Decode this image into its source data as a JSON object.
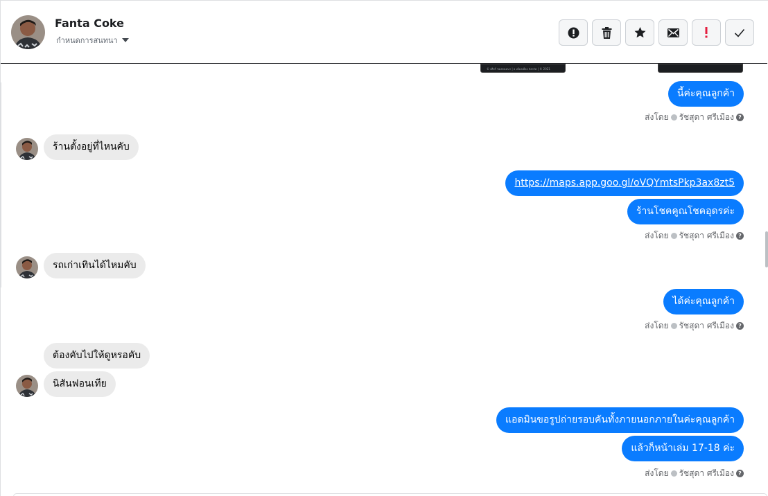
{
  "header": {
    "contact_name": "Fanta Coke",
    "conversation_settings": "กำหนดการสนทนา",
    "actions": [
      {
        "name": "report-icon"
      },
      {
        "name": "trash-icon"
      },
      {
        "name": "star-icon"
      },
      {
        "name": "envelope-icon"
      },
      {
        "name": "exclamation-icon"
      },
      {
        "name": "checkmark-icon"
      }
    ]
  },
  "messages": {
    "out_1": "นี้ค่ะคุณลูกค้า",
    "in_1": "ร้านตั้งอยู่ที่ไหนคับ",
    "out_link": "https://maps.app.goo.gl/oVQYmtsPkp3ax8zt5",
    "out_2": "ร้านโชคคูณโชคอุดรค่ะ",
    "in_2": "รถเก่าเทินได้ไหมคับ",
    "out_3": "ได้ค่ะคุณลูกค้า",
    "in_3": "ต้องคับไปให้ดูหรอคับ",
    "in_4": "นิสันฟอนเทีย",
    "out_4": "แอดมินขอรูปถ่ายรอบคันทั้งภายนอกภายในค่ะคุณลูกค้า",
    "out_5": "แล้วก็หน้าเล่ม 17-18 ค่ะ"
  },
  "sent_by": {
    "prefix": "ส่งโดย",
    "agent": "รัชสุดา ศรีเมือง"
  },
  "thumbnails": {
    "left_caption": "© เทียร์ ของคนหนา  |  อ เมืองเมือง จังหวัด  |  © 2021"
  },
  "colors": {
    "outgoing_bubble": "#0a7cff",
    "incoming_bubble": "#ebebeb",
    "exclamation_red": "#e41e3f"
  }
}
